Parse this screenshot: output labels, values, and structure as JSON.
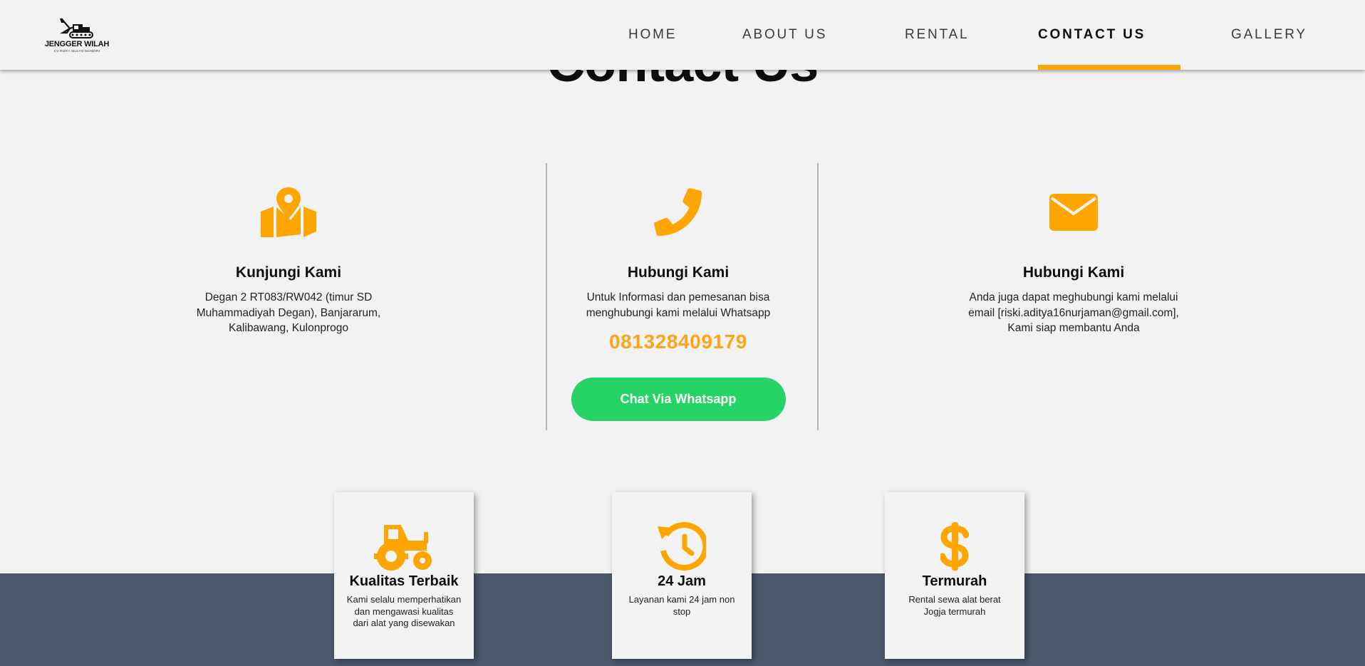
{
  "page": {
    "title": "Contact Us"
  },
  "logo": {
    "name": "JENGGER WILAH",
    "subtitle": "CV RIZKY MULYO MANDIRI"
  },
  "nav": {
    "items": [
      "HOME",
      "ABOUT US",
      "RENTAL",
      "CONTACT US",
      "GALLERY"
    ],
    "active": "CONTACT US"
  },
  "contact": {
    "visit": {
      "icon": "map-pin-icon",
      "title": "Kunjungi Kami",
      "lines": [
        "Degan 2 RT083/RW042 (timur SD",
        "Muhammadiyah Degan), Banjararum,",
        "Kalibawang, Kulonprogo"
      ]
    },
    "phone": {
      "icon": "phone-icon",
      "title": "Hubungi Kami",
      "lines": [
        "Untuk Informasi dan pemesanan bisa",
        "menghubungi kami melalui Whatsapp"
      ],
      "number": "081328409179",
      "button_label": "Chat Via Whatsapp"
    },
    "email": {
      "icon": "envelope-icon",
      "title": "Hubungi Kami",
      "lines": [
        "Anda juga dapat meghubungi kami melalui",
        "email [riski.aditya16nurjaman@gmail.com],",
        "Kami siap membantu Anda"
      ]
    }
  },
  "features": [
    {
      "icon": "tractor-icon",
      "title": "Kualitas Terbaik",
      "lines": [
        "Kami selalu memperhatikan",
        "dan mengawasi kualitas",
        "dari alat yang disewakan"
      ]
    },
    {
      "icon": "history-clock-icon",
      "title": "24 Jam",
      "lines": [
        "Layanan kami 24 jam non",
        "stop"
      ]
    },
    {
      "icon": "dollar-icon",
      "title": "Termurah",
      "lines": [
        "Rental sewa alat berat",
        "Jogja termurah"
      ]
    }
  ],
  "colors": {
    "accent": "#ffa500",
    "whatsapp": "#25d366",
    "footer": "#4b596b",
    "background": "#f2f2f2"
  }
}
